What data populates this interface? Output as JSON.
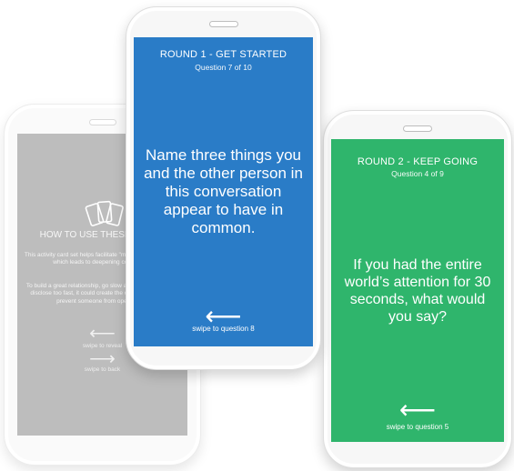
{
  "left_phone": {
    "title": "HOW TO USE THESE CARDS",
    "paragraph1": "This activity card set helps facilitate \"mutual self-disclosure\" which leads to deepening connection.",
    "paragraph2": "To build a great relationship, go slow and reciprocal. If you disclose too fast, it could create the opposite effect and prevent someone from opening up.",
    "swipe_next": "swipe to reveal",
    "swipe_back": "swipe to back",
    "arrow_left": "⟵",
    "arrow_right": "⟶"
  },
  "middle_phone": {
    "round_title": "ROUND 1 - GET STARTED",
    "question_count": "Question 7 of 10",
    "question": "Name three things you and the other person in this conversation appear to have in common.",
    "arrow": "⟵",
    "swipe_label": "swipe to question 8",
    "color": "#2a7cc7"
  },
  "right_phone": {
    "round_title": "ROUND 2 - KEEP GOING",
    "question_count": "Question 4 of 9",
    "question": "If you had the entire world’s attention for 30 seconds, what would you say?",
    "arrow": "⟵",
    "swipe_label": "swipe to question 5",
    "color": "#2fb56c"
  }
}
